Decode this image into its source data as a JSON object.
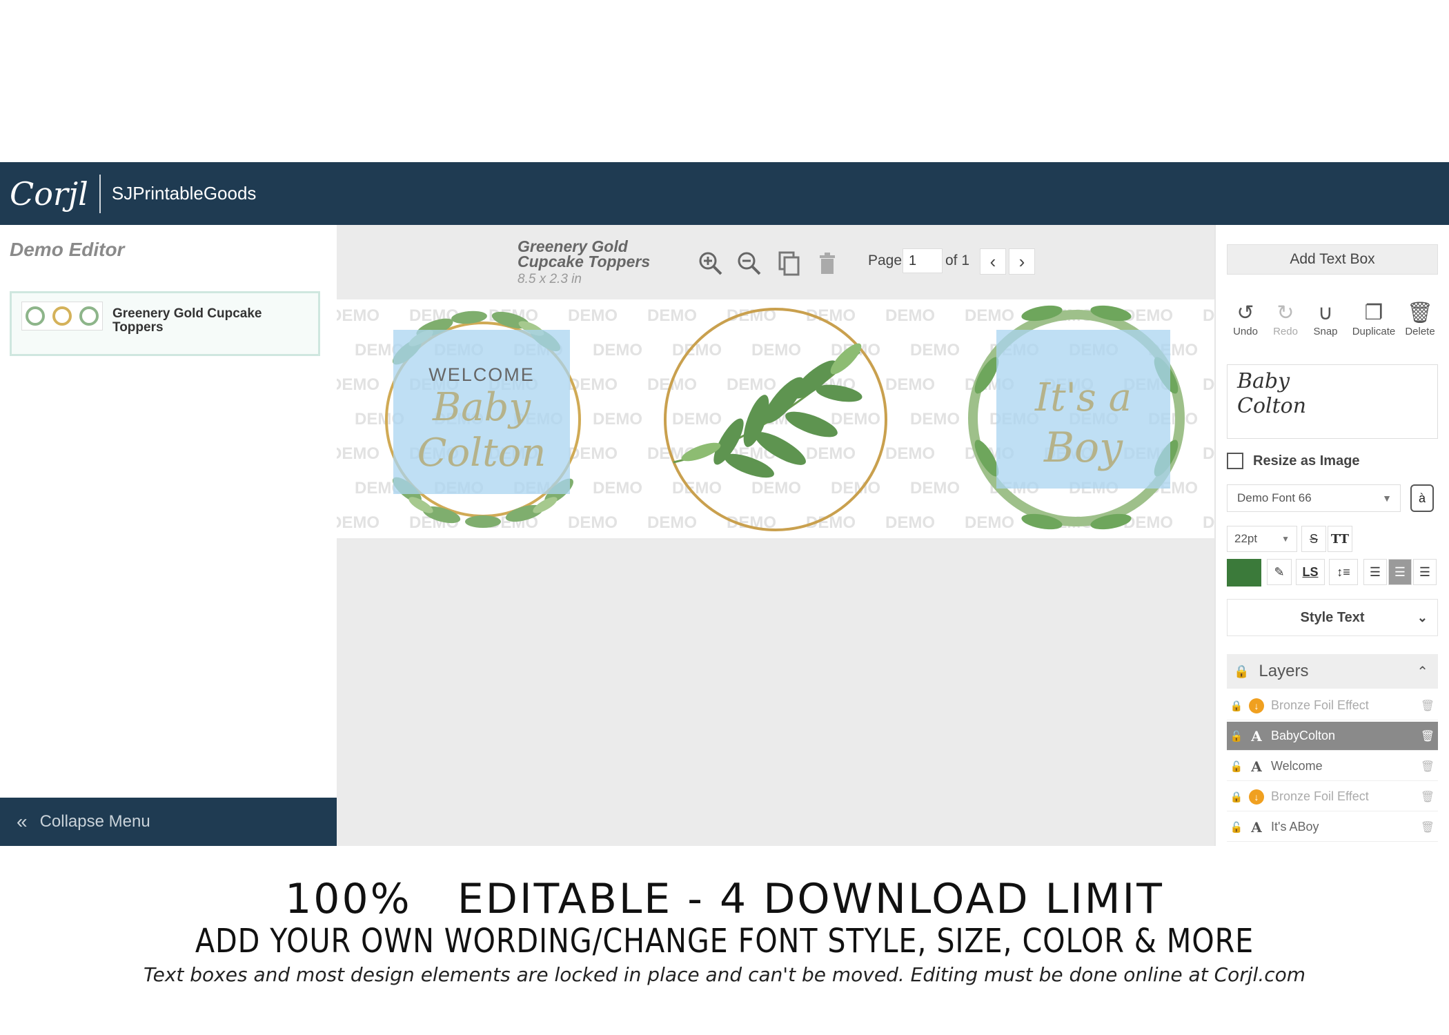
{
  "header": {
    "logo": "Corjl",
    "brand": "SJPrintableGoods"
  },
  "sidebar": {
    "title": "Demo Editor",
    "project_title": "Greenery Gold Cupcake Toppers",
    "collapse_label": "Collapse Menu"
  },
  "canvas": {
    "doc_title": "Greenery Gold Cupcake Toppers",
    "doc_size": "8.5 x 2.3 in",
    "page_label": "Page",
    "page_value": "1",
    "page_of": "of 1",
    "watermark": "DEMO",
    "topper1_line1": "WELCOME",
    "topper1_line2": "Baby",
    "topper1_line3": "Colton",
    "topper3_line1": "It's a",
    "topper3_line2": "Boy"
  },
  "panel": {
    "add_text_box": "Add Text Box",
    "tools": [
      {
        "label": "Undo",
        "icon": "undo-icon"
      },
      {
        "label": "Redo",
        "icon": "redo-icon"
      },
      {
        "label": "Snap",
        "icon": "magnet-icon"
      },
      {
        "label": "Duplicate",
        "icon": "duplicate-icon"
      },
      {
        "label": "Delete",
        "icon": "trash-icon"
      }
    ],
    "preview_line1": "Baby",
    "preview_line2": "Colton",
    "resize_as_image": "Resize as Image",
    "font_name": "Demo Font 66",
    "font_size": "22pt",
    "strike_label": "S",
    "caps_label": "TT",
    "ls_label": "LS",
    "text_color": "#3b7a3a",
    "style_text": "Style Text",
    "layers_title": "Layers",
    "layers": [
      {
        "name": "Bronze Foil Effect",
        "type": "bronze",
        "locked": true,
        "selected": false
      },
      {
        "name": "BabyColton",
        "type": "text",
        "locked": false,
        "selected": true
      },
      {
        "name": "Welcome",
        "type": "text",
        "locked": false,
        "selected": false
      },
      {
        "name": "Bronze Foil Effect",
        "type": "bronze",
        "locked": true,
        "selected": false
      },
      {
        "name": "It's ABoy",
        "type": "text",
        "locked": false,
        "selected": false
      }
    ]
  },
  "footer": {
    "line1": "100%   EDITABLE - 4 DOWNLOAD LIMIT",
    "line2": "ADD YOUR OWN WORDING/CHANGE FONT STYLE, SIZE, COLOR & MORE",
    "line3": "Text boxes and most design elements are locked in place and can't be moved. Editing must be done online at Corjl.com"
  }
}
